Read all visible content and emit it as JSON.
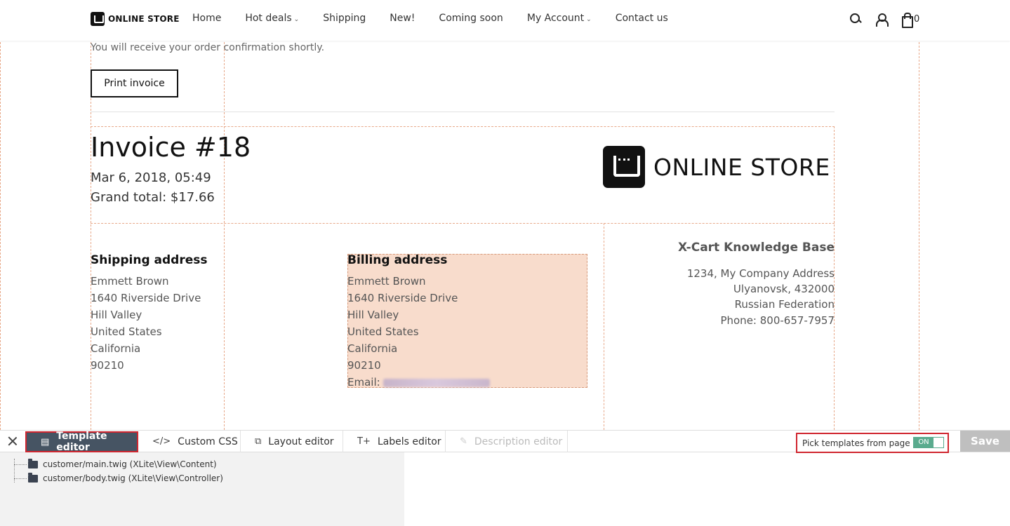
{
  "header": {
    "logo_text": "ONLINE STORE",
    "nav": [
      {
        "label": "Home",
        "dropdown": false
      },
      {
        "label": "Hot deals",
        "dropdown": true
      },
      {
        "label": "Shipping",
        "dropdown": false
      },
      {
        "label": "New!",
        "dropdown": false
      },
      {
        "label": "Coming soon",
        "dropdown": false
      },
      {
        "label": "My Account",
        "dropdown": true
      },
      {
        "label": "Contact us",
        "dropdown": false
      }
    ],
    "icons": [
      "search-icon",
      "user-icon",
      "cart-icon"
    ],
    "cart_count": "0"
  },
  "main": {
    "confirmation": "You will receive your order confirmation shortly.",
    "print_button": "Print invoice",
    "invoice": {
      "title": "Invoice #18",
      "date": "Mar 6, 2018, 05:49",
      "grand_total": "Grand total: $17.66",
      "logo_text": "ONLINE STORE"
    },
    "shipping": {
      "title": "Shipping address",
      "lines": [
        "Emmett  Brown",
        "1640 Riverside Drive",
        "Hill Valley",
        "United States",
        "California",
        "90210"
      ]
    },
    "billing": {
      "title": "Billing address",
      "lines": [
        "Emmett  Brown",
        "1640 Riverside Drive",
        "Hill Valley",
        "United States",
        "California",
        "90210"
      ],
      "email_label": "Email:"
    },
    "company": {
      "name": "X-Cart Knowledge Base",
      "address": "1234, My Company Address",
      "city": "Ulyanovsk, 432000",
      "country": "Russian Federation",
      "phone": "Phone: 800-657-7957"
    }
  },
  "toolbar": {
    "buttons": [
      {
        "label": "Template editor",
        "icon": "template-icon",
        "active": true
      },
      {
        "label": "Custom CSS",
        "icon": "code-icon",
        "active": false
      },
      {
        "label": "Layout editor",
        "icon": "layout-icon",
        "active": false
      },
      {
        "label": "Labels editor",
        "icon": "text-icon",
        "active": false
      },
      {
        "label": "Description editor",
        "icon": "edit-icon",
        "disabled": true
      }
    ],
    "pick_label": "Pick templates from page",
    "toggle_state": "ON",
    "save_label": "Save",
    "accent_color": "#5aab8e",
    "highlight_color": "#d0262f"
  },
  "tree": {
    "items": [
      {
        "label": "customer/main.twig (XLite\\View\\Content)"
      },
      {
        "label": "customer/body.twig (XLite\\View\\Controller)"
      }
    ]
  }
}
